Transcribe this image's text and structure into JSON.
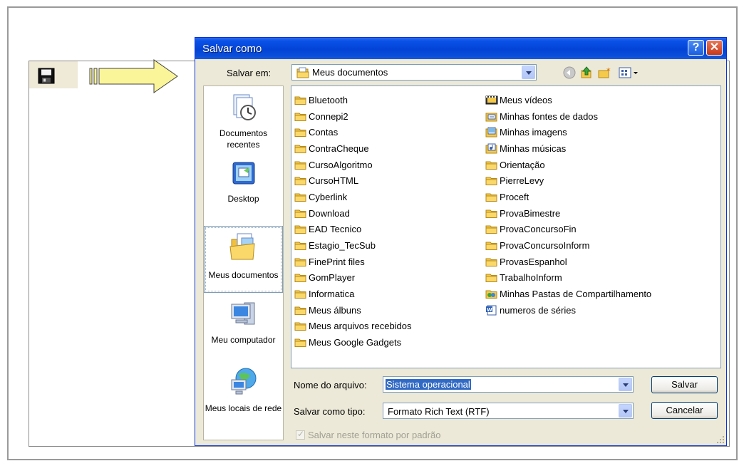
{
  "dialog": {
    "title": "Salvar como",
    "help_label": "?",
    "close_label": "✕",
    "look_in_label": "Salvar em:",
    "look_in_value": "Meus documentos"
  },
  "places": [
    {
      "label": "Documentos recentes",
      "icon": "recent-documents-icon"
    },
    {
      "label": "Desktop",
      "icon": "desktop-icon"
    },
    {
      "label": "Meus documentos",
      "icon": "my-documents-icon",
      "selected": true
    },
    {
      "label": "Meu computador",
      "icon": "my-computer-icon"
    },
    {
      "label": "Meus locais de rede",
      "icon": "network-places-icon"
    }
  ],
  "files": {
    "column1": [
      "Bluetooth",
      "Connepi2",
      "Contas",
      "ContraCheque",
      "CursoAlgoritmo",
      "CursoHTML",
      "Cyberlink",
      "Download",
      "EAD Tecnico",
      "Estagio_TecSub",
      "FinePrint files",
      "GomPlayer",
      "Informatica",
      "Meus álbuns",
      "Meus arquivos recebidos",
      "Meus Google Gadgets"
    ],
    "column2": [
      "Meus vídeos",
      "Minhas fontes de dados",
      "Minhas imagens",
      "Minhas músicas",
      "Orientação",
      "PierreLevy",
      "Proceft",
      "ProvaBimestre",
      "ProvaConcursoFin",
      "ProvaConcursoInform",
      "ProvasEspanhol",
      "TrabalhoInform",
      "Minhas Pastas de Compartilhamento",
      "numeros de séries"
    ]
  },
  "form": {
    "filename_label": "Nome do arquivo:",
    "filename_value": "Sistema operacional",
    "filetype_label": "Salvar como tipo:",
    "filetype_value": "Formato Rich Text (RTF)",
    "save_button": "Salvar",
    "cancel_button": "Cancelar",
    "default_format_checkbox": "Salvar neste formato por padrão"
  },
  "colors": {
    "titlebar": "#0a4fd9",
    "dialog_bg": "#ece9d8",
    "folder": "#f5c94a",
    "arrow": "#fbf59a"
  }
}
